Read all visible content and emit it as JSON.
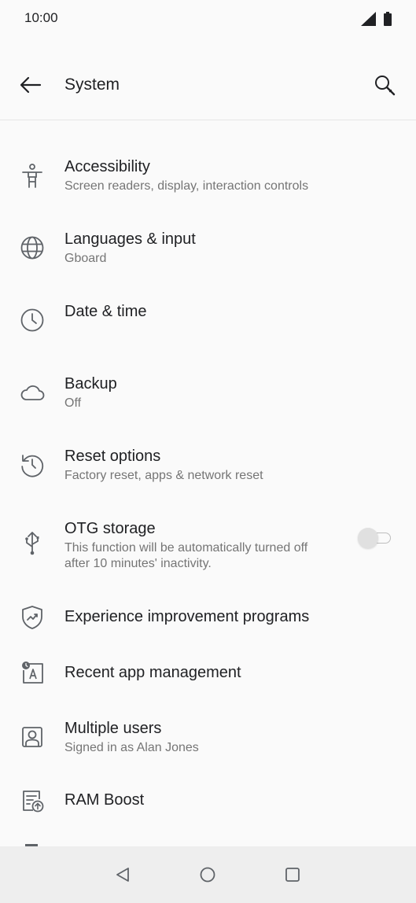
{
  "status_bar": {
    "time": "10:00"
  },
  "app_bar": {
    "title": "System"
  },
  "items": [
    {
      "title": "Accessibility",
      "subtitle": "Screen readers, display, interaction controls",
      "icon": "accessibility-icon"
    },
    {
      "title": "Languages & input",
      "subtitle": "Gboard",
      "icon": "globe-icon"
    },
    {
      "title": "Date & time",
      "subtitle": "",
      "icon": "clock-icon"
    },
    {
      "title": "Backup",
      "subtitle": "Off",
      "icon": "cloud-icon"
    },
    {
      "title": "Reset options",
      "subtitle": "Factory reset, apps & network reset",
      "icon": "history-icon"
    },
    {
      "title": "OTG storage",
      "subtitle": "This function will be automatically turned off after 10 minutes' inactivity.",
      "icon": "usb-icon",
      "toggle_on": false
    },
    {
      "title": "Experience improvement programs",
      "subtitle": "",
      "icon": "shield-chart-icon"
    },
    {
      "title": "Recent app management",
      "subtitle": "",
      "icon": "recent-apps-icon"
    },
    {
      "title": "Multiple users",
      "subtitle": "Signed in as Alan Jones",
      "icon": "user-icon"
    },
    {
      "title": "RAM Boost",
      "subtitle": "",
      "icon": "ram-boost-icon"
    }
  ],
  "colors": {
    "background": "#fafafa",
    "text_primary": "#202124",
    "text_secondary": "#757575",
    "icon": "#5f6368",
    "nav_bar": "#eeeeee"
  }
}
